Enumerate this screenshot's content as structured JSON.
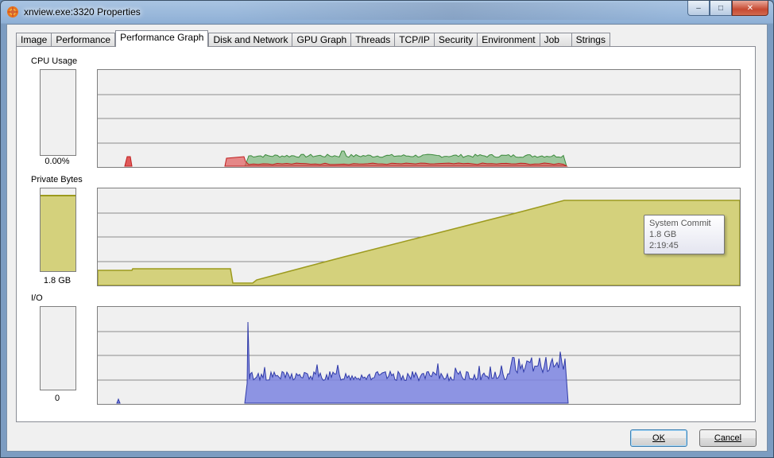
{
  "window": {
    "title": "xnview.exe:3320 Properties",
    "minimize_label": "–",
    "maximize_label": "□",
    "close_label": "✕"
  },
  "tabs": [
    {
      "label": "Image"
    },
    {
      "label": "Performance"
    },
    {
      "label": "Performance Graph",
      "active": true
    },
    {
      "label": "Disk and Network"
    },
    {
      "label": "GPU Graph"
    },
    {
      "label": "Threads"
    },
    {
      "label": "TCP/IP"
    },
    {
      "label": "Security"
    },
    {
      "label": "Environment"
    },
    {
      "label": "Job"
    },
    {
      "label": "Strings"
    }
  ],
  "sections": {
    "cpu": {
      "label": "CPU Usage",
      "value": "0.00%",
      "meter_fraction": 0.0
    },
    "private_bytes": {
      "label": "Private Bytes",
      "value": "1.8 GB",
      "meter_fraction": 0.9
    },
    "io": {
      "label": "I/O",
      "value": "0",
      "meter_fraction": 0.0
    }
  },
  "tooltip": {
    "line1": "System Commit",
    "line2": "1.8 GB",
    "line3": "2:19:45"
  },
  "buttons": {
    "ok": "OK",
    "cancel": "Cancel"
  },
  "colors": {
    "cpu_kernel": "#e05a5a",
    "cpu_total": "#5aa65a",
    "private_bytes": "#d4d17c",
    "private_bytes_line": "#9c9a1e",
    "io": "#7b84e0",
    "io_line": "#2f3aa8"
  }
}
